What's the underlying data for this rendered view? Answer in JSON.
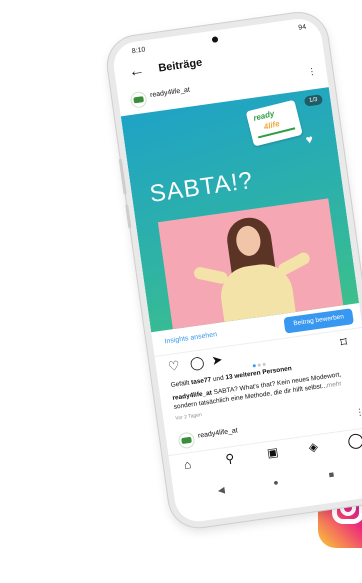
{
  "status": {
    "time": "8:10",
    "icons": "94"
  },
  "header": {
    "back": "←",
    "title": "Beiträge"
  },
  "account": {
    "name": "ready4life_at",
    "more": "⋮"
  },
  "post": {
    "headline": "SABTA!?",
    "badge_line1": "ready",
    "badge_line2": "4life",
    "counter": "1/3",
    "heart": "♥"
  },
  "insights": {
    "link": "Insights ansehen",
    "promote_button": "Beitrag bewerben"
  },
  "actions": {
    "like": "♡",
    "comment": "◯",
    "share": "➤",
    "save": "⌑"
  },
  "likes": {
    "prefix": "Gefällt ",
    "user": "tase77",
    "middle": " und ",
    "others": "13 weiteren Personen"
  },
  "caption": {
    "user": "ready4life_at",
    "text": " SABTA? What's that? Kein neues Modewort, sondern tatsächlich eine Methode, die dir hilft selbst...",
    "more": "mehr"
  },
  "date": "Vor 2 Tagen",
  "next_account": {
    "name": "ready4life_at",
    "more": "⋮"
  },
  "bottom_nav": {
    "home": "⌂",
    "search": "⚲",
    "reels": "▣",
    "shop": "◈"
  },
  "system_nav": {
    "back": "◀",
    "home": "●",
    "recents": "■"
  },
  "colors": {
    "post_gradient_start": "#1fa3c6",
    "post_gradient_end": "#3cc08c",
    "link_blue": "#3897f0"
  }
}
